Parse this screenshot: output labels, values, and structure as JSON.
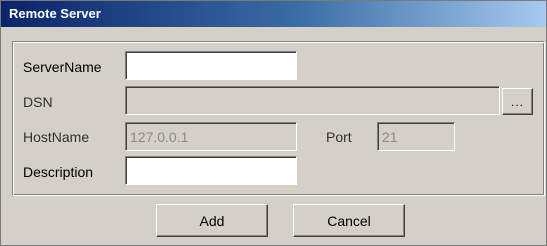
{
  "window": {
    "title": "Remote Server"
  },
  "form": {
    "server_name": {
      "label": "ServerName",
      "value": ""
    },
    "dsn": {
      "label": "DSN",
      "value": "",
      "browse_label": "..."
    },
    "host_name": {
      "label": "HostName",
      "value": "127.0.0.1"
    },
    "port": {
      "label": "Port",
      "value": "21"
    },
    "description": {
      "label": "Description",
      "value": ""
    }
  },
  "buttons": {
    "add_label": "Add",
    "cancel_label": "Cancel"
  }
}
